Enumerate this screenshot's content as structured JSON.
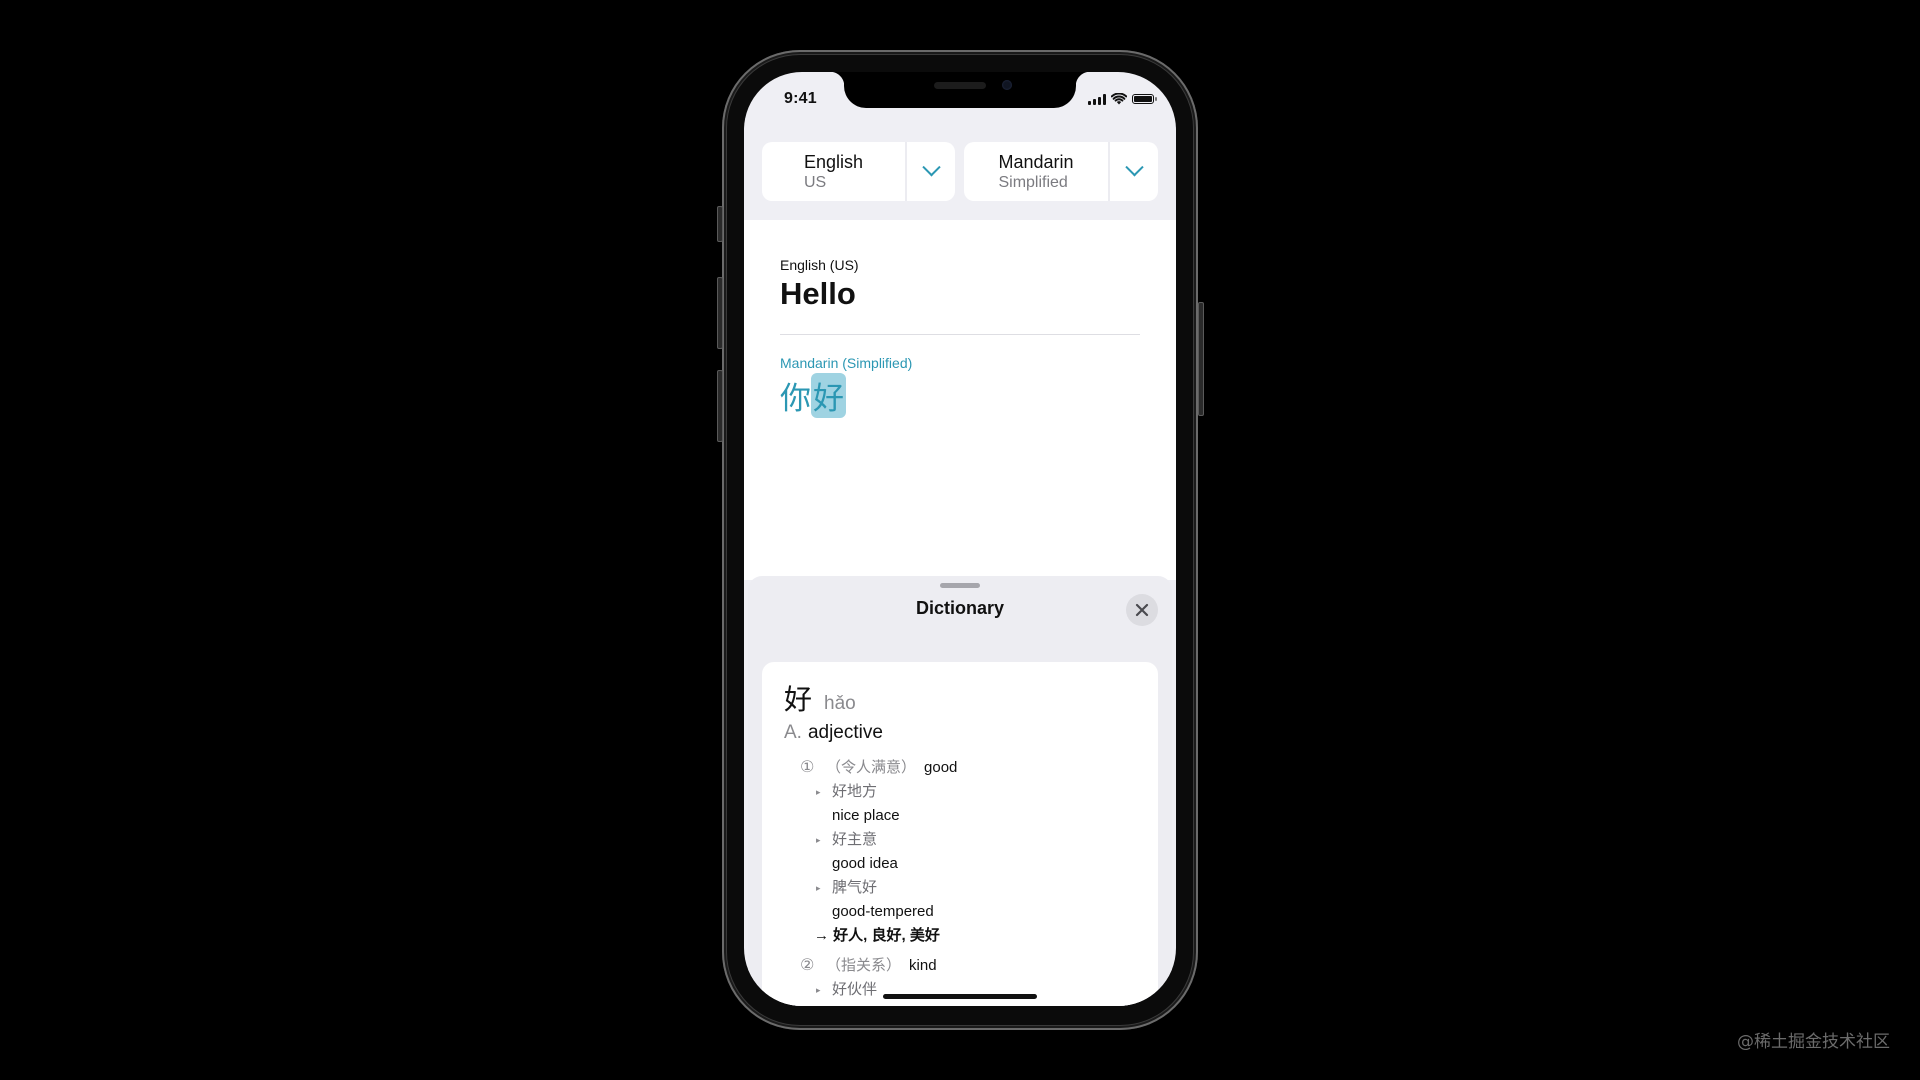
{
  "status_bar": {
    "time": "9:41",
    "icons": [
      "cellular-signal-icon",
      "wifi-icon",
      "battery-icon"
    ]
  },
  "language_selector": {
    "source": {
      "name": "English",
      "variant": "US"
    },
    "target": {
      "name": "Mandarin",
      "variant": "Simplified"
    },
    "toggle_icon": "chevron-down-icon"
  },
  "translation": {
    "source_label": "English (US)",
    "source_text": "Hello",
    "target_label": "Mandarin (Simplified)",
    "target_text_plain": "你",
    "target_text_highlighted": "好"
  },
  "dictionary": {
    "title": "Dictionary",
    "close_icon": "close-icon",
    "entry": {
      "headword": "好",
      "pinyin": "hǎo",
      "part_of_speech_letter": "A.",
      "part_of_speech": "adjective",
      "senses": [
        {
          "number": "①",
          "gloss": "（令人满意）",
          "meaning": "good",
          "examples": [
            {
              "zh": "好地方",
              "en": "nice place"
            },
            {
              "zh": "好主意",
              "en": "good idea"
            },
            {
              "zh": "脾气好",
              "en": "good-tempered"
            }
          ],
          "see_also": "→ 好人, 良好, 美好"
        },
        {
          "number": "②",
          "gloss": "（指关系）",
          "meaning": "kind",
          "examples": [
            {
              "zh": "好伙伴",
              "en": ""
            }
          ]
        }
      ]
    }
  },
  "colors": {
    "accent": "#2b97b3",
    "highlight": "#9fd3e2",
    "background": "#efeff4"
  },
  "watermark": "@稀土掘金技术社区"
}
